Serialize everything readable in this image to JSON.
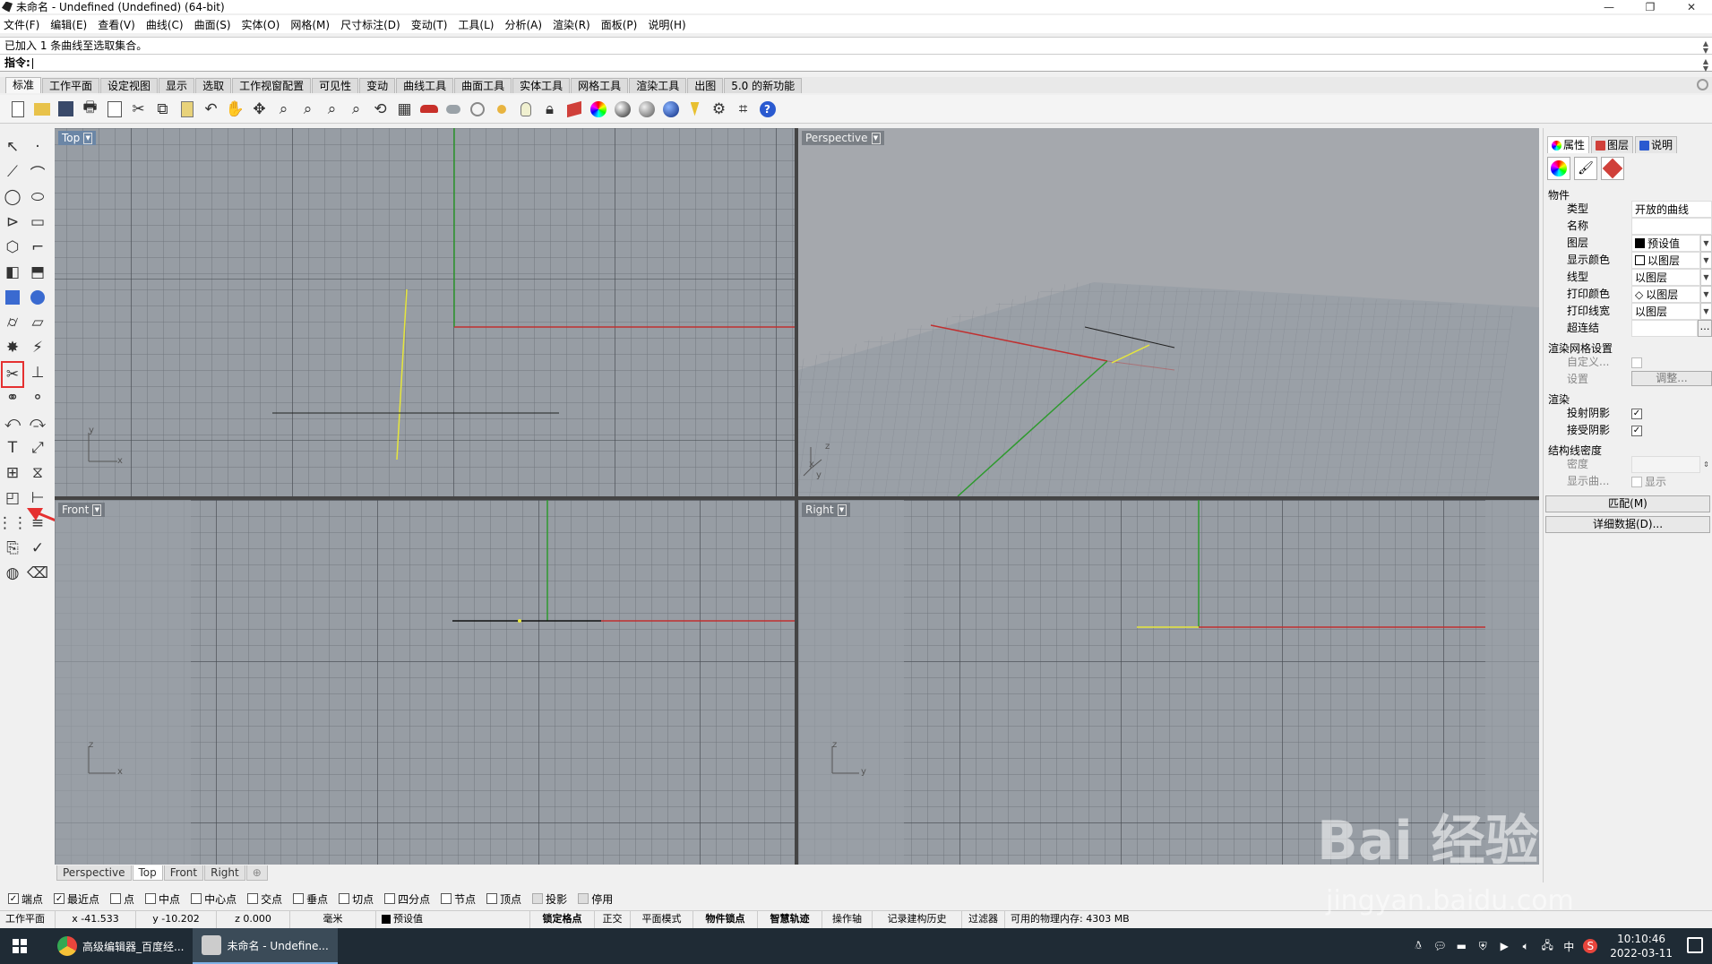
{
  "window": {
    "title": "未命名 - Undefined (Undefined) (64-bit)",
    "minimize": "—",
    "maximize": "❐",
    "close": "✕"
  },
  "menu": [
    "文件(F)",
    "编辑(E)",
    "查看(V)",
    "曲线(C)",
    "曲面(S)",
    "实体(O)",
    "网格(M)",
    "尺寸标注(D)",
    "变动(T)",
    "工具(L)",
    "分析(A)",
    "渲染(R)",
    "面板(P)",
    "说明(H)"
  ],
  "command": {
    "history": "已加入 1 条曲线至选取集合。",
    "prompt": "指令:"
  },
  "tabs": [
    "标准",
    "工作平面",
    "设定视图",
    "显示",
    "选取",
    "工作视窗配置",
    "可见性",
    "变动",
    "曲线工具",
    "曲面工具",
    "实体工具",
    "网格工具",
    "渲染工具",
    "出图",
    "5.0 的新功能"
  ],
  "active_tab": "标准",
  "toolbar_icons": [
    "new-file-icon",
    "open-file-icon",
    "save-icon",
    "print-icon",
    "import-icon",
    "cut-icon",
    "copy-icon",
    "paste-icon",
    "undo-icon",
    "pan-hand-icon",
    "rotate-view-icon",
    "zoom-icon",
    "zoom-window-icon",
    "zoom-extents-icon",
    "zoom-selected-icon",
    "undo-view-icon",
    "four-viewports-icon",
    "car-icon",
    "shaded-icon",
    "circle-target-icon",
    "select-filter-icon",
    "lightbulb-icon",
    "lock-icon",
    "layer-icon",
    "color-wheel-icon",
    "sphere-icon",
    "sphere-shaded-icon",
    "render-sphere-icon",
    "pin-icon",
    "gear-tools-icon",
    "snap-icon",
    "help-icon"
  ],
  "viewports": {
    "top": {
      "label": "Top",
      "axis_y": "y",
      "axis_x": "x"
    },
    "perspective": {
      "label": "Perspective",
      "axis_y": "y",
      "axis_x": "x",
      "axis_z": "z"
    },
    "front": {
      "label": "Front",
      "axis_z": "z",
      "axis_x": "x"
    },
    "right": {
      "label": "Right",
      "axis_z": "z",
      "axis_y": "y"
    }
  },
  "viewport_tabs": [
    "Perspective",
    "Top",
    "Front",
    "Right"
  ],
  "viewport_tab_add": "⊕",
  "active_viewport_tab": "Top",
  "properties": {
    "tabs": [
      "属性",
      "图层",
      "说明"
    ],
    "section_object": "物件",
    "rows": [
      {
        "key": "类型",
        "value": "开放的曲线"
      },
      {
        "key": "名称",
        "value": ""
      },
      {
        "key": "图层",
        "value": "预设值"
      },
      {
        "key": "显示颜色",
        "value": "以图层"
      },
      {
        "key": "线型",
        "value": "以图层"
      },
      {
        "key": "打印颜色",
        "value": "以图层"
      },
      {
        "key": "打印线宽",
        "value": "以图层"
      },
      {
        "key": "超连结",
        "value": ""
      }
    ],
    "section_render_mesh": "渲染网格设置",
    "custom_label": "自定义...",
    "settings_label": "设置",
    "adjust_button": "调整...",
    "section_render": "渲染",
    "cast_shadow": "投射阴影",
    "receive_shadow": "接受阴影",
    "section_isocurve": "结构线密度",
    "density_label": "密度",
    "show_curve_label": "显示曲...",
    "show_label": "显示",
    "match_button": "匹配(M)",
    "details_button": "详细数据(D)..."
  },
  "osnaps": [
    {
      "label": "端点",
      "checked": true
    },
    {
      "label": "最近点",
      "checked": true
    },
    {
      "label": "点",
      "checked": false
    },
    {
      "label": "中点",
      "checked": false
    },
    {
      "label": "中心点",
      "checked": false
    },
    {
      "label": "交点",
      "checked": false
    },
    {
      "label": "垂点",
      "checked": false
    },
    {
      "label": "切点",
      "checked": false
    },
    {
      "label": "四分点",
      "checked": false
    },
    {
      "label": "节点",
      "checked": false
    },
    {
      "label": "顶点",
      "checked": false
    },
    {
      "label": "投影",
      "checked": false
    },
    {
      "label": "停用",
      "checked": false
    }
  ],
  "status": {
    "cplane": "工作平面",
    "x": "x -41.533",
    "y": "y -10.202",
    "z": "z 0.000",
    "units": "毫米",
    "layer": "预设值",
    "grid_snap": "锁定格点",
    "ortho": "正交",
    "planar": "平面模式",
    "osnap": "物件锁点",
    "smarttrack": "智慧轨迹",
    "gumball": "操作轴",
    "history": "记录建构历史",
    "filter": "过滤器",
    "memory": "可用的物理内存: 4303 MB"
  },
  "taskbar": {
    "apps": [
      {
        "label": "高级编辑器_百度经...",
        "color": "#e8453c"
      },
      {
        "label": "未命名 - Undefine...",
        "color": "#dddddd"
      }
    ],
    "time": "10:10:46",
    "date": "2022-03-11",
    "ime": "中"
  },
  "watermark": {
    "logo": "Bai 经验",
    "url": "jingyan.baidu.com"
  },
  "colors": {
    "viewport_bg": "#979da4",
    "active_label": "#6b86a6",
    "x_axis": "#c03030",
    "y_axis": "#2e9a2e",
    "selected_curve": "#e6e63c",
    "highlight": "#e53030"
  }
}
